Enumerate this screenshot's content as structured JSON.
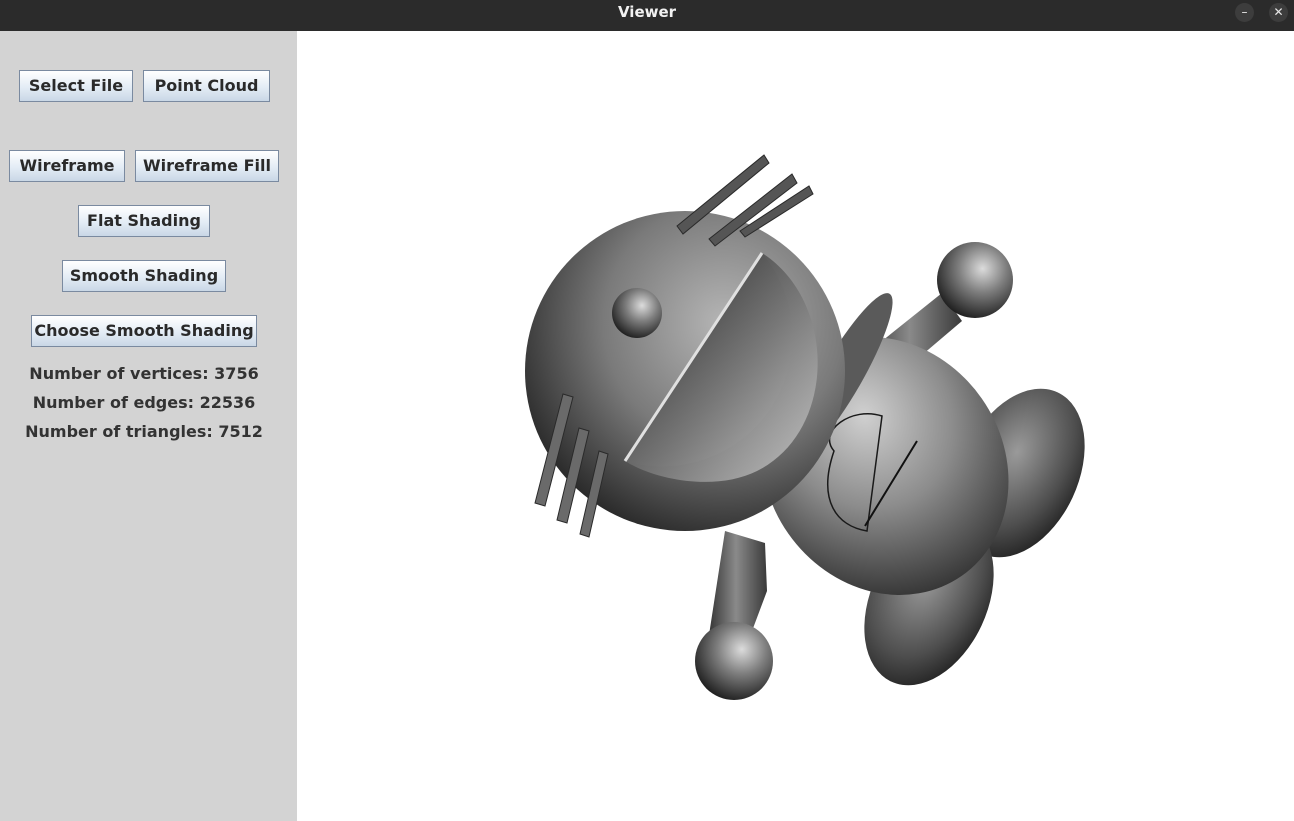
{
  "window": {
    "title": "Viewer",
    "minimize_glyph": "–",
    "close_glyph": "✕"
  },
  "sidebar": {
    "buttons": {
      "select_file": "Select File",
      "point_cloud": "Point Cloud",
      "wireframe": "Wireframe",
      "wireframe_fill": "Wireframe Fill",
      "flat_shading": "Flat Shading",
      "smooth_shading": "Smooth Shading",
      "choose_smooth_shading": "Choose Smooth Shading"
    },
    "stats": {
      "vertices": "Number of vertices: 3756",
      "edges": "Number of edges: 22536",
      "triangles": "Number of triangles: 7512"
    }
  },
  "colors": {
    "sidebar_bg": "#d3d3d3",
    "titlebar_bg": "#2b2b2b",
    "mesh_gray": "#7a7a7a"
  }
}
